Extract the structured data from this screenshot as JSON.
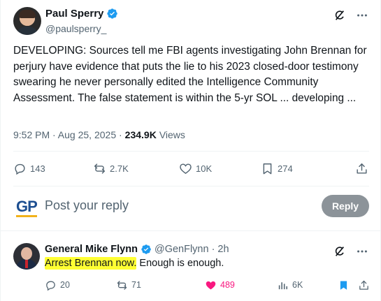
{
  "main_tweet": {
    "author_name": "Paul Sperry",
    "author_handle": "@paulsperry_",
    "text": "DEVELOPING: Sources tell me FBI agents investigating John Brennan for perjury have evidence that puts the lie to his 2023 closed-door testimony swearing he never personally edited the Intelligence Community Assessment. The false statement is within the 5-yr SOL ... developing ...",
    "timestamp": "9:52 PM · Aug 25, 2025 ·",
    "views_count": "234.9K",
    "views_label": "Views",
    "stats": {
      "replies": "143",
      "reposts": "2.7K",
      "likes": "10K",
      "bookmarks": "274"
    }
  },
  "reply_box": {
    "logo_text": "GP",
    "placeholder": "Post your reply",
    "button_label": "Reply"
  },
  "reply_tweet": {
    "author_name": "General Mike Flynn",
    "author_handle": "@GenFlynn",
    "separator": "·",
    "time": "2h",
    "text_highlighted": "Arrest Brennan now.",
    "text_rest": " Enough is enough.",
    "stats": {
      "replies": "20",
      "reposts": "71",
      "likes": "489",
      "views": "6K"
    }
  },
  "colors": {
    "verified": "#1d9bf0",
    "secondary_text": "#536471",
    "liked_pink": "#f91880",
    "bookmarked_blue": "#1d9bf0",
    "highlight": "#ffff33",
    "reply_button_disabled": "#8c9399"
  },
  "icons": [
    "verified-badge-icon",
    "grok-icon",
    "more-icon",
    "reply-icon",
    "repost-icon",
    "like-icon",
    "bookmark-icon",
    "share-icon",
    "views-icon"
  ]
}
